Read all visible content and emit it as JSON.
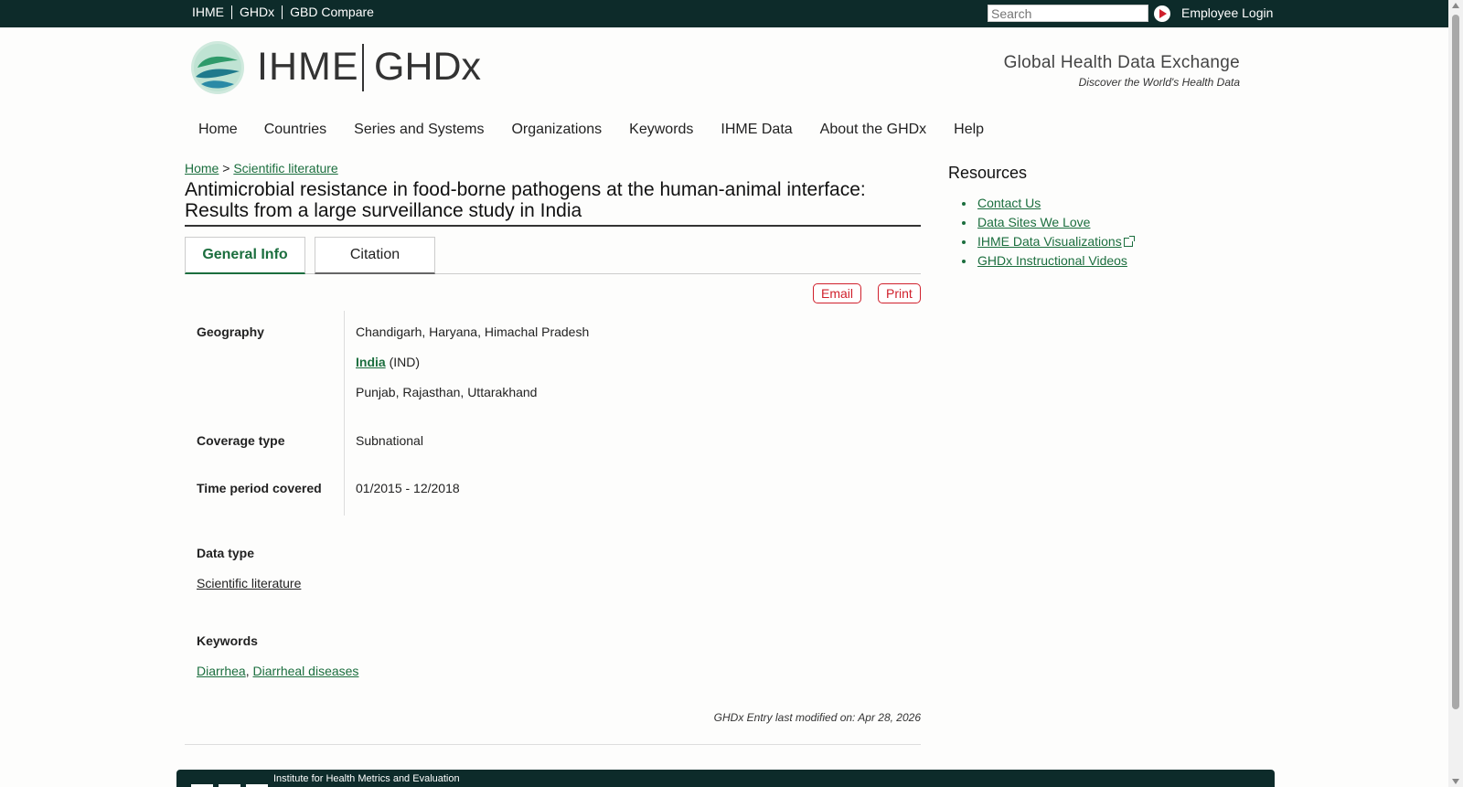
{
  "topbar": {
    "links": [
      "IHME",
      "GHDx",
      "GBD Compare"
    ],
    "search_placeholder": "Search",
    "employee_login": "Employee Login"
  },
  "header": {
    "logo_ihme": "IHME",
    "logo_ghdx": "GHDx",
    "tagline_title": "Global Health Data Exchange",
    "tagline_sub": "Discover the World's Health Data"
  },
  "nav": {
    "items": [
      "Home",
      "Countries",
      "Series and Systems",
      "Organizations",
      "Keywords",
      "IHME Data",
      "About the GHDx",
      "Help"
    ]
  },
  "breadcrumb": {
    "home": "Home",
    "sep": ">",
    "current": "Scientific literature"
  },
  "page": {
    "title": "Antimicrobial resistance in food-borne pathogens at the human-animal interface: Results from a large surveillance study in India"
  },
  "tabs": {
    "general_info": "General Info",
    "citation": "Citation"
  },
  "actions": {
    "email": "Email",
    "print": "Print"
  },
  "details": {
    "geography_label": "Geography",
    "geography_1": "Chandigarh, Haryana, Himachal Pradesh",
    "geography_country": "India",
    "geography_country_code": "(IND)",
    "geography_3": "Punjab, Rajasthan, Uttarakhand",
    "coverage_label": "Coverage type",
    "coverage_value": "Subnational",
    "time_label": "Time period covered",
    "time_value": "01/2015 - 12/2018",
    "data_type_label": "Data type",
    "data_type_value": "Scientific literature",
    "keywords_label": "Keywords",
    "keyword_1": "Diarrhea",
    "keyword_sep": ",",
    "keyword_2": "Diarrheal diseases"
  },
  "modified": "GHDx Entry last modified on: Apr 28, 2026",
  "sidebar": {
    "title": "Resources",
    "items": [
      "Contact Us",
      "Data Sites We Love",
      "IHME Data Visualizations",
      "GHDx Instructional Videos"
    ]
  },
  "footer": {
    "org_name": "Institute for Health Metrics and Evaluation"
  },
  "colors": {
    "dark_green": "#0d2b2a",
    "link_green": "#1b6e3e",
    "action_red": "#d0202c"
  }
}
